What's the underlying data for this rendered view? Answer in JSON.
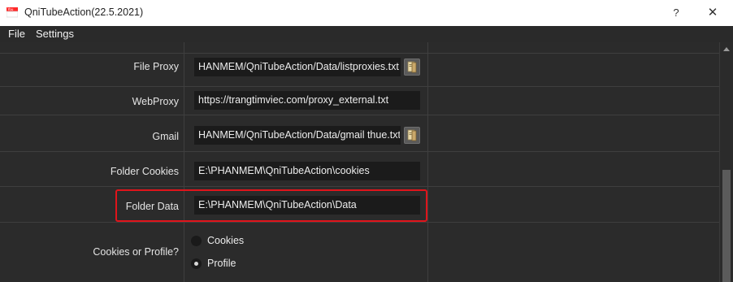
{
  "window": {
    "title": "QniTubeAction(22.5.2021)",
    "help_label": "?",
    "close_label": "✕"
  },
  "menu": {
    "file": "File",
    "settings": "Settings"
  },
  "settings": {
    "file_proxy": {
      "label": "File Proxy",
      "value": "HANMEM/QniTubeAction/Data/listproxies.txt"
    },
    "webproxy": {
      "label": "WebProxy",
      "value": "https://trangtimviec.com/proxy_external.txt"
    },
    "gmail": {
      "label": "Gmail",
      "value": "HANMEM/QniTubeAction/Data/gmail thue.txt"
    },
    "folder_cookies": {
      "label": "Folder Cookies",
      "value": "E:\\PHANMEM\\QniTubeAction\\cookies"
    },
    "folder_data": {
      "label": "Folder Data",
      "value": "E:\\PHANMEM\\QniTubeAction\\Data"
    },
    "cookies_or_profile": {
      "label": "Cookies or Profile?",
      "options": [
        "Cookies",
        "Profile"
      ],
      "selected": "Profile"
    }
  },
  "colors": {
    "highlight": "#e0141b",
    "background": "#2b2b2b",
    "field": "#1b1b1b"
  }
}
